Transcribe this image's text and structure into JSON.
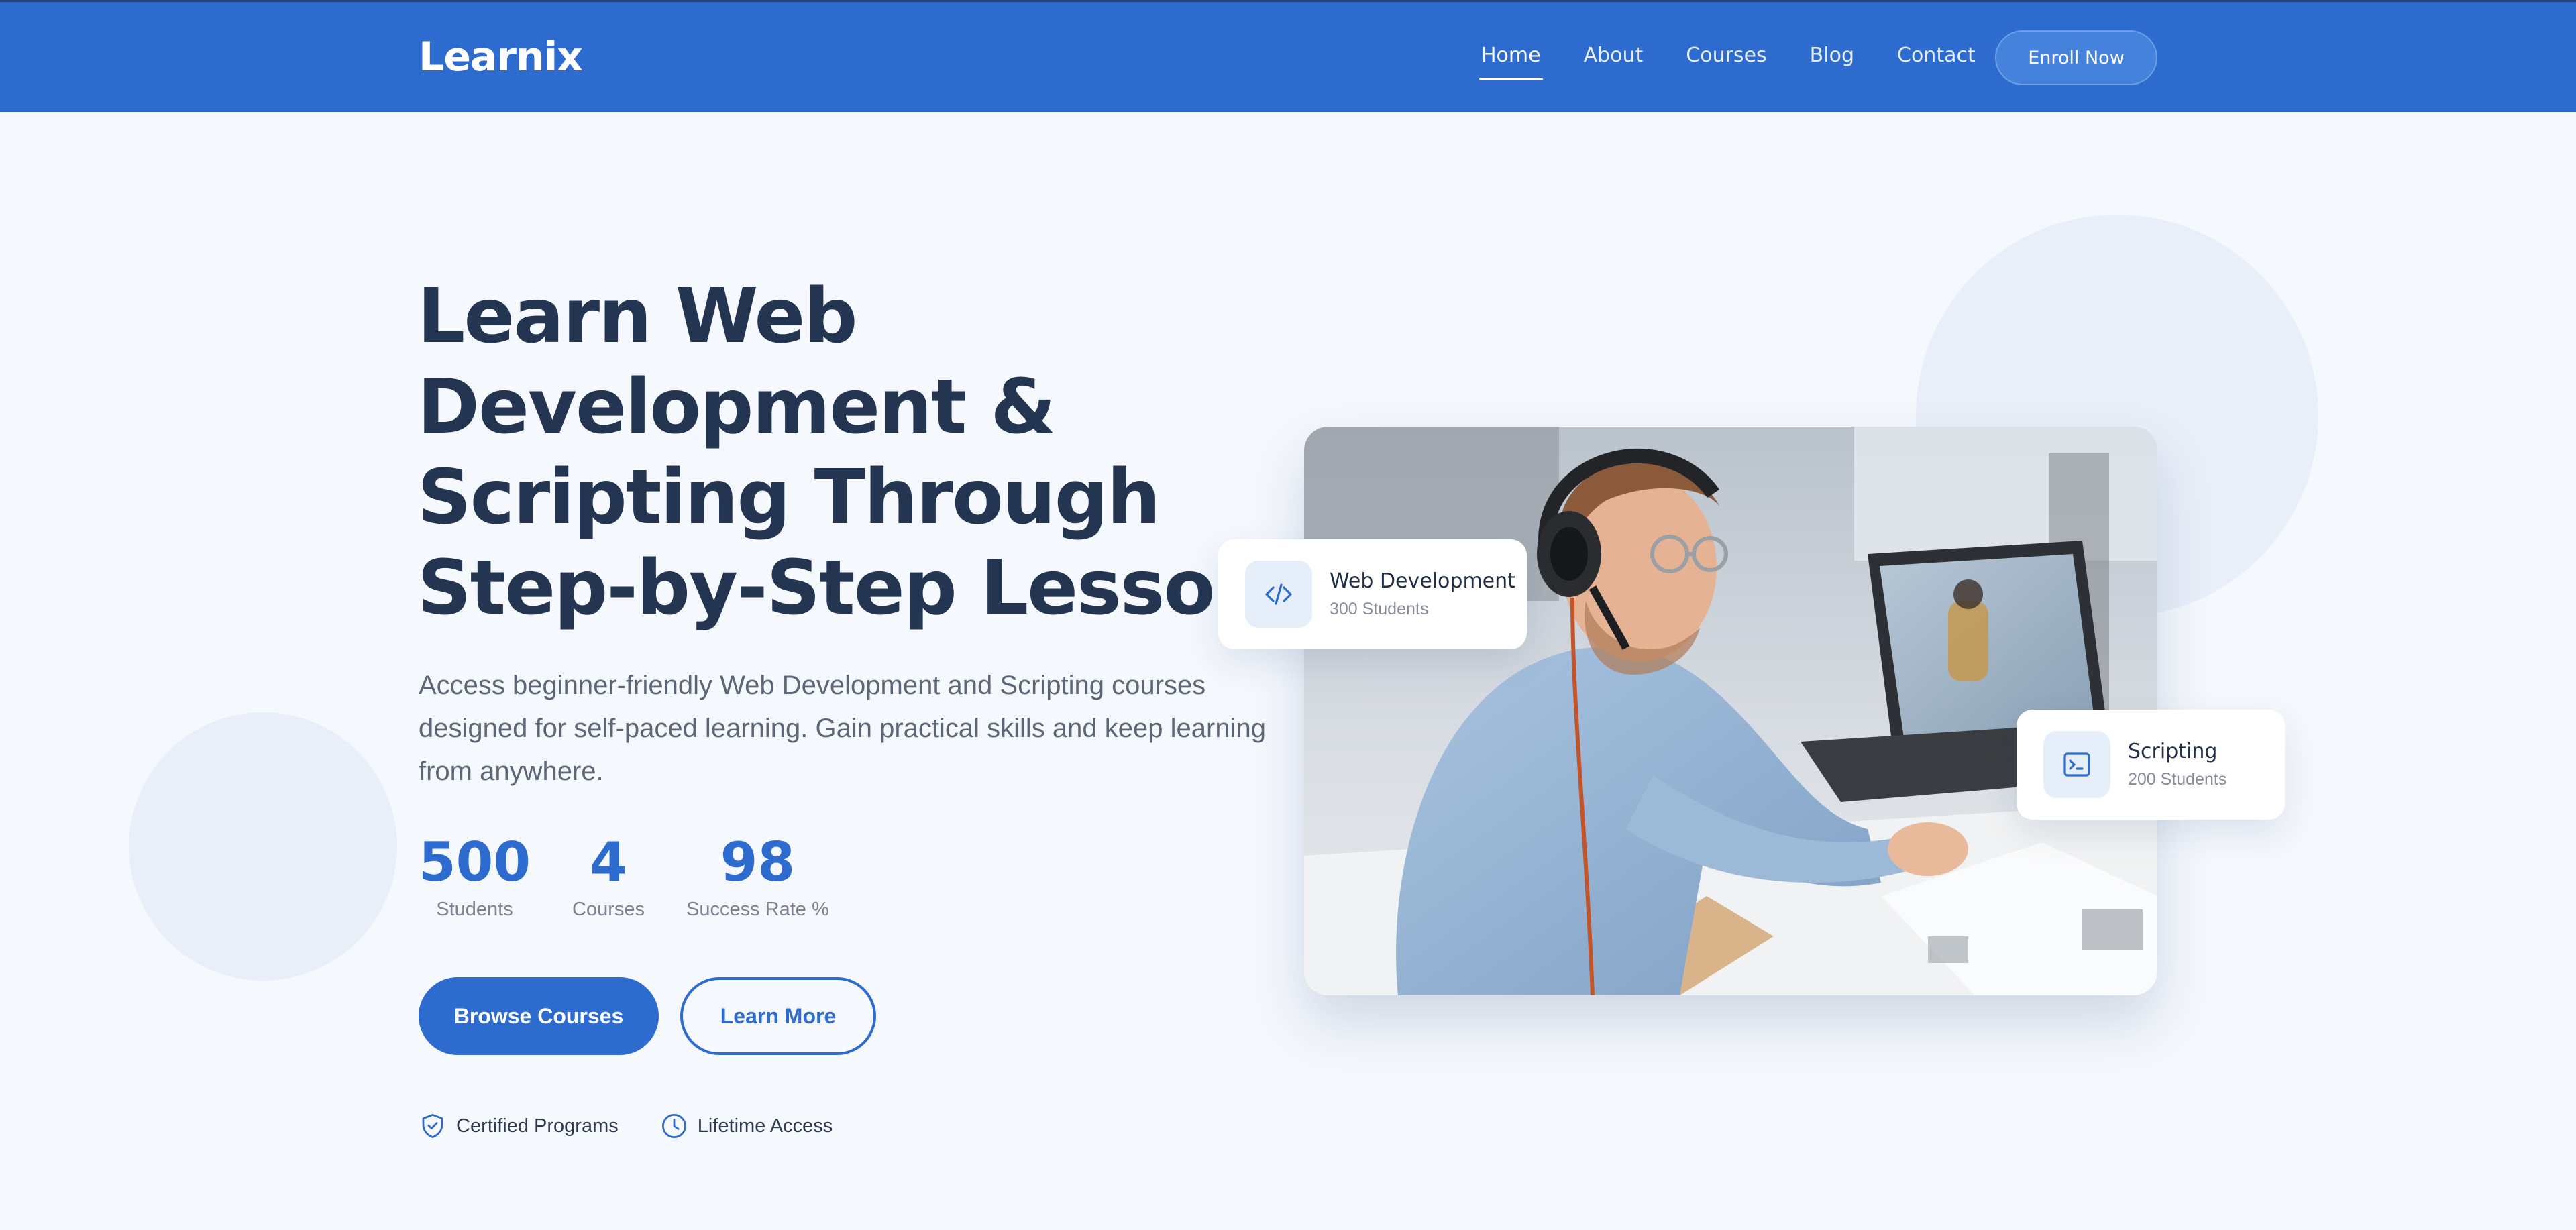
{
  "nav": {
    "brand": "Learnix",
    "links": [
      {
        "label": "Home",
        "active": true
      },
      {
        "label": "About",
        "active": false
      },
      {
        "label": "Courses",
        "active": false
      },
      {
        "label": "Blog",
        "active": false
      },
      {
        "label": "Contact",
        "active": false
      }
    ],
    "cta_label": "Enroll Now"
  },
  "hero": {
    "title_lines": [
      "Learn Web",
      "Development &",
      "Scripting Through",
      "Step-by-Step Lessons"
    ],
    "description": "Access beginner-friendly Web Development and Scripting courses designed for self-paced learning. Gain practical skills and keep learning from anywhere.",
    "stats": [
      {
        "value": "500",
        "label": "Students"
      },
      {
        "value": "4",
        "label": "Courses"
      },
      {
        "value": "98",
        "label": "Success Rate %"
      }
    ],
    "primary_button": "Browse Courses",
    "secondary_button": "Learn More",
    "badges": [
      {
        "icon": "shield-check-icon",
        "label": "Certified Programs"
      },
      {
        "icon": "clock-icon",
        "label": "Lifetime Access"
      }
    ]
  },
  "cards": {
    "web": {
      "icon": "code-icon",
      "title": "Web Development",
      "subtitle": "300 Students"
    },
    "script": {
      "icon": "terminal-icon",
      "title": "Scripting",
      "subtitle": "200 Students"
    }
  },
  "colors": {
    "primary": "#2d6bcf",
    "heading": "#243552",
    "background": "#f5f8fd"
  }
}
